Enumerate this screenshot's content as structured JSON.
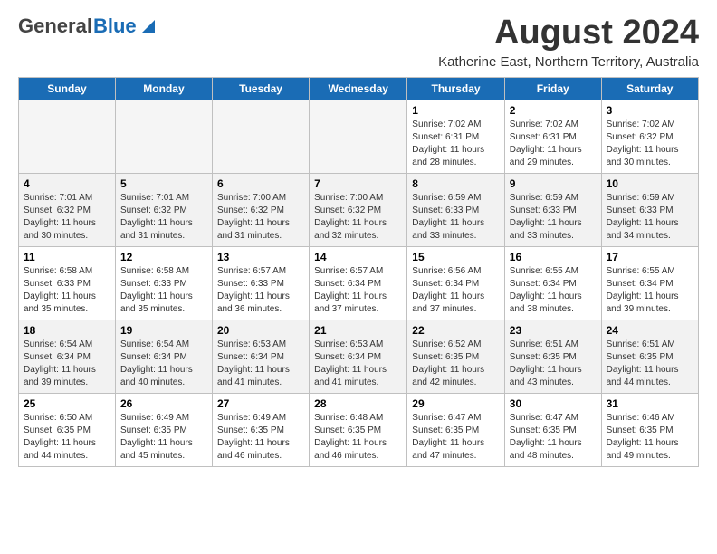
{
  "header": {
    "logo_general": "General",
    "logo_blue": "Blue",
    "month": "August 2024",
    "location": "Katherine East, Northern Territory, Australia"
  },
  "weekdays": [
    "Sunday",
    "Monday",
    "Tuesday",
    "Wednesday",
    "Thursday",
    "Friday",
    "Saturday"
  ],
  "weeks": [
    [
      {
        "day": "",
        "info": ""
      },
      {
        "day": "",
        "info": ""
      },
      {
        "day": "",
        "info": ""
      },
      {
        "day": "",
        "info": ""
      },
      {
        "day": "1",
        "info": "Sunrise: 7:02 AM\nSunset: 6:31 PM\nDaylight: 11 hours and 28 minutes."
      },
      {
        "day": "2",
        "info": "Sunrise: 7:02 AM\nSunset: 6:31 PM\nDaylight: 11 hours and 29 minutes."
      },
      {
        "day": "3",
        "info": "Sunrise: 7:02 AM\nSunset: 6:32 PM\nDaylight: 11 hours and 30 minutes."
      }
    ],
    [
      {
        "day": "4",
        "info": "Sunrise: 7:01 AM\nSunset: 6:32 PM\nDaylight: 11 hours and 30 minutes."
      },
      {
        "day": "5",
        "info": "Sunrise: 7:01 AM\nSunset: 6:32 PM\nDaylight: 11 hours and 31 minutes."
      },
      {
        "day": "6",
        "info": "Sunrise: 7:00 AM\nSunset: 6:32 PM\nDaylight: 11 hours and 31 minutes."
      },
      {
        "day": "7",
        "info": "Sunrise: 7:00 AM\nSunset: 6:32 PM\nDaylight: 11 hours and 32 minutes."
      },
      {
        "day": "8",
        "info": "Sunrise: 6:59 AM\nSunset: 6:33 PM\nDaylight: 11 hours and 33 minutes."
      },
      {
        "day": "9",
        "info": "Sunrise: 6:59 AM\nSunset: 6:33 PM\nDaylight: 11 hours and 33 minutes."
      },
      {
        "day": "10",
        "info": "Sunrise: 6:59 AM\nSunset: 6:33 PM\nDaylight: 11 hours and 34 minutes."
      }
    ],
    [
      {
        "day": "11",
        "info": "Sunrise: 6:58 AM\nSunset: 6:33 PM\nDaylight: 11 hours and 35 minutes."
      },
      {
        "day": "12",
        "info": "Sunrise: 6:58 AM\nSunset: 6:33 PM\nDaylight: 11 hours and 35 minutes."
      },
      {
        "day": "13",
        "info": "Sunrise: 6:57 AM\nSunset: 6:33 PM\nDaylight: 11 hours and 36 minutes."
      },
      {
        "day": "14",
        "info": "Sunrise: 6:57 AM\nSunset: 6:34 PM\nDaylight: 11 hours and 37 minutes."
      },
      {
        "day": "15",
        "info": "Sunrise: 6:56 AM\nSunset: 6:34 PM\nDaylight: 11 hours and 37 minutes."
      },
      {
        "day": "16",
        "info": "Sunrise: 6:55 AM\nSunset: 6:34 PM\nDaylight: 11 hours and 38 minutes."
      },
      {
        "day": "17",
        "info": "Sunrise: 6:55 AM\nSunset: 6:34 PM\nDaylight: 11 hours and 39 minutes."
      }
    ],
    [
      {
        "day": "18",
        "info": "Sunrise: 6:54 AM\nSunset: 6:34 PM\nDaylight: 11 hours and 39 minutes."
      },
      {
        "day": "19",
        "info": "Sunrise: 6:54 AM\nSunset: 6:34 PM\nDaylight: 11 hours and 40 minutes."
      },
      {
        "day": "20",
        "info": "Sunrise: 6:53 AM\nSunset: 6:34 PM\nDaylight: 11 hours and 41 minutes."
      },
      {
        "day": "21",
        "info": "Sunrise: 6:53 AM\nSunset: 6:34 PM\nDaylight: 11 hours and 41 minutes."
      },
      {
        "day": "22",
        "info": "Sunrise: 6:52 AM\nSunset: 6:35 PM\nDaylight: 11 hours and 42 minutes."
      },
      {
        "day": "23",
        "info": "Sunrise: 6:51 AM\nSunset: 6:35 PM\nDaylight: 11 hours and 43 minutes."
      },
      {
        "day": "24",
        "info": "Sunrise: 6:51 AM\nSunset: 6:35 PM\nDaylight: 11 hours and 44 minutes."
      }
    ],
    [
      {
        "day": "25",
        "info": "Sunrise: 6:50 AM\nSunset: 6:35 PM\nDaylight: 11 hours and 44 minutes."
      },
      {
        "day": "26",
        "info": "Sunrise: 6:49 AM\nSunset: 6:35 PM\nDaylight: 11 hours and 45 minutes."
      },
      {
        "day": "27",
        "info": "Sunrise: 6:49 AM\nSunset: 6:35 PM\nDaylight: 11 hours and 46 minutes."
      },
      {
        "day": "28",
        "info": "Sunrise: 6:48 AM\nSunset: 6:35 PM\nDaylight: 11 hours and 46 minutes."
      },
      {
        "day": "29",
        "info": "Sunrise: 6:47 AM\nSunset: 6:35 PM\nDaylight: 11 hours and 47 minutes."
      },
      {
        "day": "30",
        "info": "Sunrise: 6:47 AM\nSunset: 6:35 PM\nDaylight: 11 hours and 48 minutes."
      },
      {
        "day": "31",
        "info": "Sunrise: 6:46 AM\nSunset: 6:35 PM\nDaylight: 11 hours and 49 minutes."
      }
    ]
  ]
}
